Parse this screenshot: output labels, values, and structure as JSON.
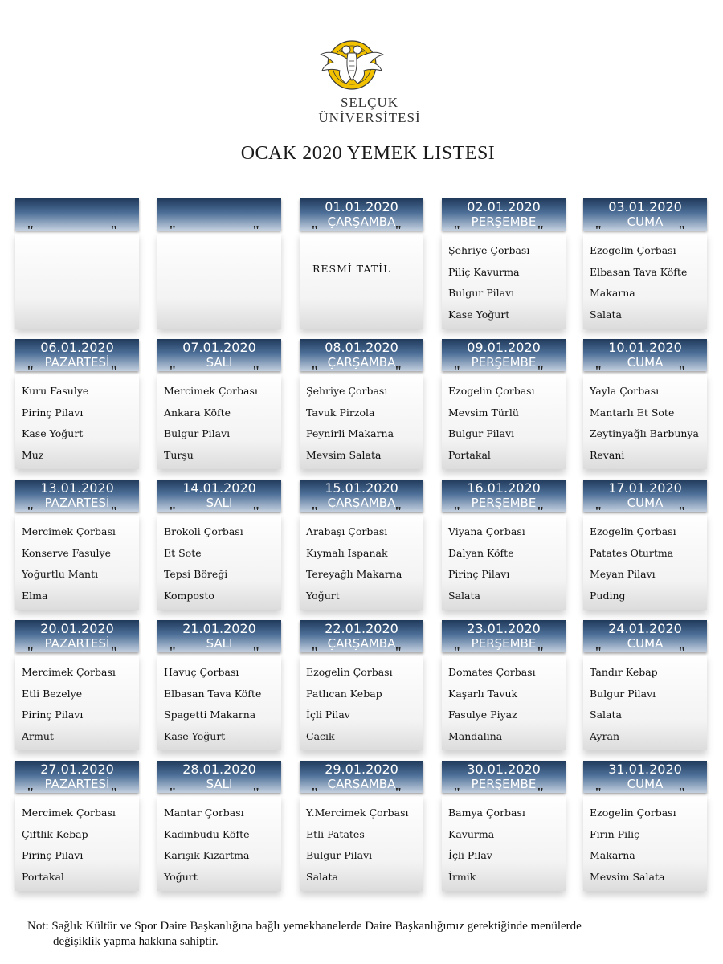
{
  "header": {
    "logo_name": "selcuk-university-seal",
    "university_line1": "SELÇUK",
    "university_line2": "ÜNİVERSİTESİ",
    "title": "OCAK 2020 YEMEK LISTESI"
  },
  "quote_mark": "\"",
  "holiday_text": "RESMİ TATİL",
  "colors": {
    "header_dark": "#203a5b",
    "header_mid": "#4d6f98",
    "header_light": "#c4d0df"
  },
  "rows": [
    [
      {
        "date": "",
        "day": "",
        "items": []
      },
      {
        "date": "",
        "day": "",
        "items": []
      },
      {
        "date": "01.01.2020",
        "day": "ÇARŞAMBA",
        "holiday": true,
        "items": []
      },
      {
        "date": "02.01.2020",
        "day": "PERŞEMBE",
        "items": [
          "Şehriye Çorbası",
          "Piliç Kavurma",
          "Bulgur Pilavı",
          "Kase Yoğurt"
        ]
      },
      {
        "date": "03.01.2020",
        "day": "CUMA",
        "items": [
          "Ezogelin Çorbası",
          "Elbasan Tava Köfte",
          "Makarna",
          "Salata"
        ]
      }
    ],
    [
      {
        "date": "06.01.2020",
        "day": "PAZARTESİ",
        "items": [
          "Kuru Fasulye",
          "Pirinç Pilavı",
          "Kase Yoğurt",
          "Muz"
        ]
      },
      {
        "date": "07.01.2020",
        "day": "SALI",
        "items": [
          "Mercimek Çorbası",
          "Ankara Köfte",
          "Bulgur Pilavı",
          "Turşu"
        ]
      },
      {
        "date": "08.01.2020",
        "day": "ÇARŞAMBA",
        "items": [
          "Şehriye Çorbası",
          "Tavuk Pirzola",
          "Peynirli Makarna",
          "Mevsim Salata"
        ]
      },
      {
        "date": "09.01.2020",
        "day": "PERŞEMBE",
        "items": [
          "Ezogelin Çorbası",
          "Mevsim Türlü",
          "Bulgur Pilavı",
          "Portakal"
        ]
      },
      {
        "date": "10.01.2020",
        "day": "CUMA",
        "items": [
          "Yayla Çorbası",
          "Mantarlı Et Sote",
          "Zeytinyağlı Barbunya",
          "Revani"
        ]
      }
    ],
    [
      {
        "date": "13.01.2020",
        "day": "PAZARTESİ",
        "items": [
          "Mercimek Çorbası",
          "Konserve Fasulye",
          "Yoğurtlu Mantı",
          "Elma"
        ]
      },
      {
        "date": "14.01.2020",
        "day": "SALI",
        "items": [
          "Brokoli Çorbası",
          "Et Sote",
          "Tepsi Böreği",
          "Komposto"
        ]
      },
      {
        "date": "15.01.2020",
        "day": "ÇARŞAMBA",
        "items": [
          "Arabaşı Çorbası",
          "Kıymalı Ispanak",
          "Tereyağlı Makarna",
          "Yoğurt"
        ]
      },
      {
        "date": "16.01.2020",
        "day": "PERŞEMBE",
        "items": [
          "Viyana Çorbası",
          "Dalyan Köfte",
          "Pirinç Pilavı",
          "Salata"
        ]
      },
      {
        "date": "17.01.2020",
        "day": "CUMA",
        "items": [
          "Ezogelin Çorbası",
          "Patates Oturtma",
          "Meyan Pilavı",
          "Puding"
        ]
      }
    ],
    [
      {
        "date": "20.01.2020",
        "day": "PAZARTESİ",
        "items": [
          "Mercimek Çorbası",
          "Etli Bezelye",
          "Pirinç Pilavı",
          "Armut"
        ]
      },
      {
        "date": "21.01.2020",
        "day": "SALI",
        "items": [
          "Havuç Çorbası",
          "Elbasan Tava Köfte",
          "Spagetti Makarna",
          "Kase Yoğurt"
        ]
      },
      {
        "date": "22.01.2020",
        "day": "ÇARŞAMBA",
        "items": [
          "Ezogelin Çorbası",
          "Patlıcan Kebap",
          "İçli Pilav",
          "Cacık"
        ]
      },
      {
        "date": "23.01.2020",
        "day": "PERŞEMBE",
        "items": [
          "Domates Çorbası",
          "Kaşarlı Tavuk",
          "Fasulye Piyaz",
          "Mandalina"
        ]
      },
      {
        "date": "24.01.2020",
        "day": "CUMA",
        "items": [
          "Tandır Kebap",
          "Bulgur Pilavı",
          "Salata",
          "Ayran"
        ]
      }
    ],
    [
      {
        "date": "27.01.2020",
        "day": "PAZARTESİ",
        "items": [
          "Mercimek Çorbası",
          "Çiftlik Kebap",
          "Pirinç Pilavı",
          "Portakal"
        ]
      },
      {
        "date": "28.01.2020",
        "day": "SALI",
        "items": [
          "Mantar Çorbası",
          "Kadınbudu Köfte",
          "Karışık Kızartma",
          "Yoğurt"
        ]
      },
      {
        "date": "29.01.2020",
        "day": "ÇARŞAMBA",
        "items": [
          "Y.Mercimek Çorbası",
          "Etli Patates",
          "Bulgur Pilavı",
          "Salata"
        ]
      },
      {
        "date": "30.01.2020",
        "day": "PERŞEMBE",
        "items": [
          "Bamya Çorbası",
          "Kavurma",
          "İçli Pilav",
          "İrmik"
        ]
      },
      {
        "date": "31.01.2020",
        "day": "CUMA",
        "items": [
          "Ezogelin Çorbası",
          "Fırın Piliç",
          "Makarna",
          "Mevsim Salata"
        ]
      }
    ]
  ],
  "note": {
    "label": "Not:",
    "line1": "Sağlık Kültür ve Spor Daire Başkanlığına bağlı yemekhanelerde Daire Başkanlığımız gerektiğinde menülerde",
    "line2": "değişiklik yapma hakkına sahiptir."
  }
}
